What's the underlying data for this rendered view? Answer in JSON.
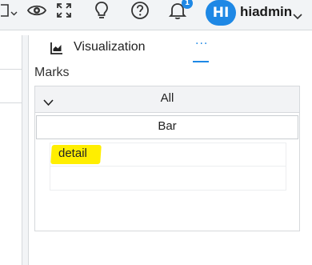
{
  "header": {
    "notification_count": "1",
    "avatar_initials": "HI",
    "username": "hiadmin",
    "icons": [
      "layout-dropdown-icon",
      "eye-icon",
      "fullscreen-icon",
      "lightbulb-icon",
      "help-icon",
      "bell-icon",
      "chevron-down-icon"
    ],
    "accent_color": "#1e88e5"
  },
  "panel": {
    "tab_title": "Visualization",
    "more_label": "···",
    "marks_label": "Marks",
    "marks_group": "All",
    "mark_type": "Bar",
    "fields": [
      "detail"
    ],
    "highlight_color": "#ffee00"
  }
}
